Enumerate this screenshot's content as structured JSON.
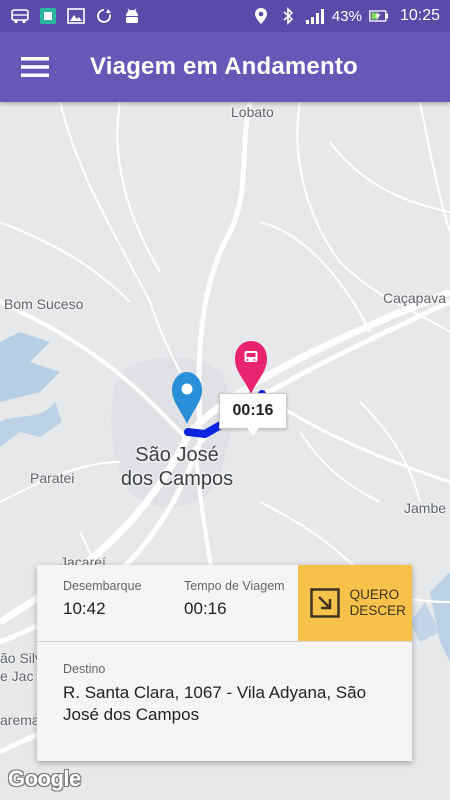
{
  "status_bar": {
    "battery": "43%",
    "time": "10:25",
    "icons": [
      "bus-icon",
      "sim-icon",
      "image-icon",
      "sync-icon",
      "android-icon",
      "location-icon",
      "bluetooth-icon",
      "signal-icon",
      "battery-charging-icon"
    ]
  },
  "app_bar": {
    "title": "Viagem em Andamento",
    "menu_icon": "hamburger-menu-icon"
  },
  "map": {
    "labels": {
      "lobato": "Lobato",
      "bom_suceso": "Bom Suceso",
      "cacapava": "Caçapava",
      "paratei": "Paratei",
      "jambe": "Jambe",
      "jacarei": "Jacareí",
      "sao_silv": "ão Silv",
      "de_jac": "e Jac",
      "arema": "arema",
      "city": "São José dos Campos"
    },
    "bubble_time": "00:16",
    "attribution": "Google",
    "colors": {
      "route": "#0a24e0",
      "destination_pin": "#e8246e",
      "origin_pin": "#2a8fd9"
    }
  },
  "trip_card": {
    "desembarque_label": "Desembarque",
    "desembarque_value": "10:42",
    "tempo_label": "Tempo de Viagem",
    "tempo_value": "00:16",
    "quero_descer_label": "QUERO DESCER",
    "destino_label": "Destino",
    "destino_value": "R. Santa Clara, 1067 - Vila Adyana, São José dos Campos"
  },
  "colors": {
    "status_bar": "#5b4aa8",
    "app_bar": "#6957b8",
    "quero_button": "#f7c24a"
  }
}
